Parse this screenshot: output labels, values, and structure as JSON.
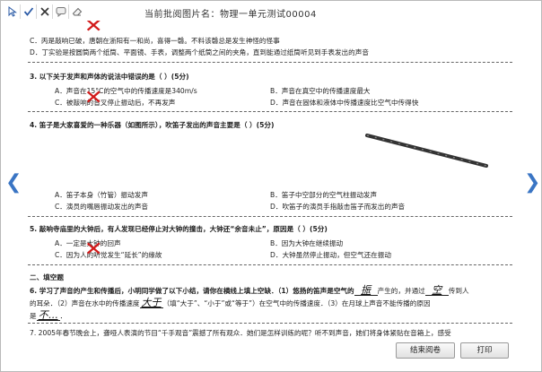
{
  "window": {
    "title": "当前批阅图片名：物理一单元测试00004"
  },
  "toolbar": {
    "tools": [
      "pointer-tool",
      "check-tool",
      "cross-tool",
      "comment-tool",
      "eraser-tool"
    ]
  },
  "nav": {
    "prev": "❮",
    "next": "❯"
  },
  "doc": {
    "top_c": "C．丙是敲响已破，唐朝在浙阳有一和尚，喜得一磬。不料该磬总是发生神怪的怪事",
    "top_d": "D．丁实验是按圆筒两个纸筒、平面镜、手表，调整两个纸筒之间的夹角，直到能通过纸筒听见到手表发出的声音",
    "q3": {
      "stem": "3. 以下关于发声和声体的说法中错误的是（    ）(5分)",
      "a": "A．声音在15°C的空气中的传播速度是340m/s",
      "b": "B．声音在真空中的传播速度最大",
      "c": "C．被敲响的音叉停止振动后，不再发声",
      "d": "D．声音在固体和液体中传播速度比空气中传得快"
    },
    "q4": {
      "stem": "4. 笛子是大家喜爱的一种乐器（如图所示），吹笛子发出的声音主要是（  ）(5分)",
      "a": "A．笛子本身（竹管）振动发声",
      "b": "B．笛子中空部分的空气柱振动发声",
      "c": "C．演员的嘴唇振动发出的声音",
      "d": "D．吹笛子的演员手指敲击笛子而发出的声音"
    },
    "q5": {
      "stem": "5. 敲响寺庙里的大钟后，有人发现已经停止对大钟的撞击，大钟还“余音未止”，原因是（  ）(5分)",
      "a": "A．一定是大钟的回声",
      "b": "B．因为大钟在继续振动",
      "c": "C．因为人的听觉发生“延长”的缘故",
      "d": "D．大钟虽然停止振动，但空气还在振动"
    },
    "section2": "二、填空题",
    "q6": {
      "line1_pre": "6. 学习了声音的产生和传播后，小明同学做了以下小结，请你在横线上填上空缺．（1）悠扬的笛声是空气的",
      "ans1": "振",
      "line1_mid": "产生的，并通过",
      "ans2": "空",
      "line1_post": "传到人",
      "line2_pre": "的耳朵．（2）声音在水中的传播速度",
      "ans3": "大于",
      "line2_mid": "（填“大于”、“小于”或“等于”）在空气中的传播速度．（3）在月球上声音不能传播的原因",
      "line3_pre": "是",
      "ans4": "不…",
      "line3_post": "．"
    },
    "q7": "7. 2005年春节晚会上，聋哑人表演的节目“千手观音”震撼了所有观众．她们是怎样训练的呢？听不到声音，她们将身体紧贴在音箱上，感受"
  },
  "buttons": {
    "finish": "结束阅卷",
    "print": "打印"
  }
}
